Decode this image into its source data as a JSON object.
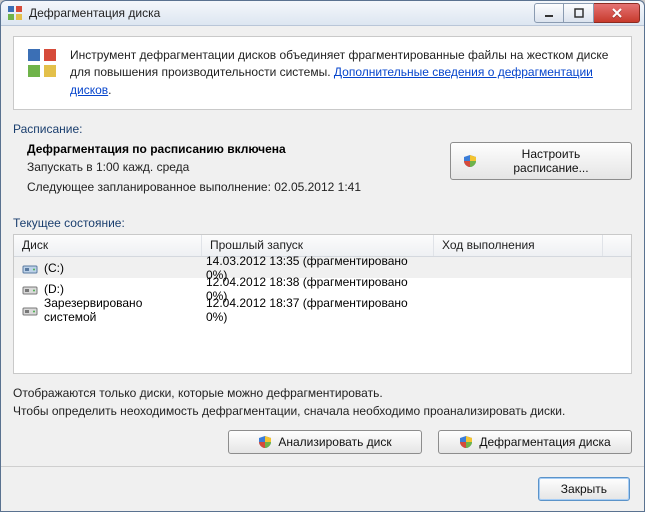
{
  "window": {
    "title": "Дефрагментация диска"
  },
  "info": {
    "text_before_link": "Инструмент дефрагментации дисков объединяет фрагментированные файлы на жестком диске для повышения производительности системы. ",
    "link_text": "Дополнительные сведения о дефрагментации дисков",
    "link_suffix": "."
  },
  "labels": {
    "schedule_section": "Расписание:",
    "current_state_section": "Текущее состояние:"
  },
  "schedule": {
    "title": "Дефрагментация по расписанию включена",
    "run_line": "Запускать в 1:00 кажд. среда",
    "next_line": "Следующее запланированное выполнение: 02.05.2012 1:41",
    "configure_button": "Настроить расписание..."
  },
  "table": {
    "headers": {
      "disk": "Диск",
      "last_run": "Прошлый запуск",
      "progress": "Ход выполнения"
    },
    "rows": [
      {
        "name": "(C:)",
        "last_run": "14.03.2012 13:35 (фрагментировано 0%)",
        "progress": "",
        "icon": "drive-c"
      },
      {
        "name": "(D:)",
        "last_run": "12.04.2012 18:38 (фрагментировано 0%)",
        "progress": "",
        "icon": "drive-d"
      },
      {
        "name": "Зарезервировано системой",
        "last_run": "12.04.2012 18:37 (фрагментировано 0%)",
        "progress": "",
        "icon": "drive-sys"
      }
    ]
  },
  "notes": {
    "line1": "Отображаются только диски, которые можно дефрагментировать.",
    "line2": "Чтобы определить неоходимость  дефрагментации, сначала необходимо проанализировать диски."
  },
  "buttons": {
    "analyze": "Анализировать диск",
    "defragment": "Дефрагментация диска",
    "close": "Закрыть"
  }
}
